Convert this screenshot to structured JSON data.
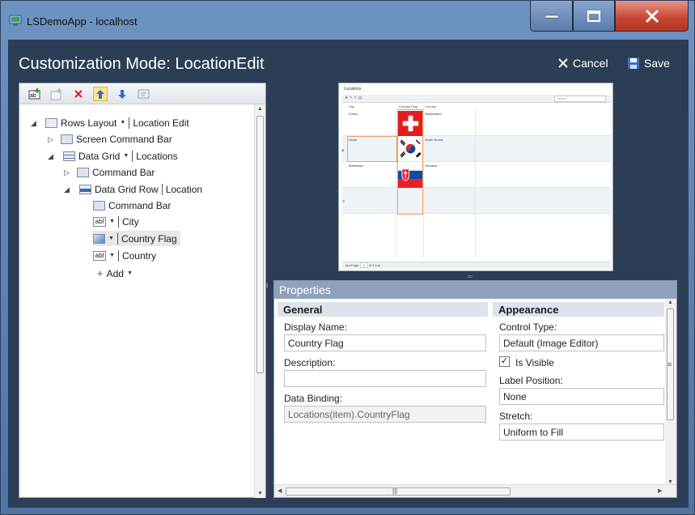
{
  "window": {
    "title": "LSDemoApp - localhost"
  },
  "header": {
    "title": "Customization Mode: LocationEdit",
    "cancel_label": "Cancel",
    "save_label": "Save"
  },
  "tree": {
    "rows_layout": "Rows Layout",
    "rows_layout_name": "Location Edit",
    "screen_command_bar": "Screen Command Bar",
    "data_grid": "Data Grid",
    "data_grid_name": "Locations",
    "command_bar": "Command Bar",
    "data_grid_row": "Data Grid Row",
    "data_grid_row_name": "Location",
    "row_command_bar": "Command Bar",
    "city": "City",
    "country_flag": "Country Flag",
    "country": "Country",
    "add": "Add",
    "textbox_icon_text": "abl"
  },
  "preview": {
    "title": "Locations",
    "search_placeholder": "Search",
    "columns": [
      "City",
      "Country Flag",
      "Country"
    ],
    "rows": [
      {
        "city": "Zurich",
        "country": "Switzerland",
        "flag": "switzerland"
      },
      {
        "city": "Seoul",
        "country": "South Korea",
        "flag": "south-korea"
      },
      {
        "city": "Bratislava",
        "country": "Slovakia",
        "flag": "slovakia"
      }
    ],
    "pager": {
      "page_label": "Page",
      "page": "1",
      "of": "of 1"
    }
  },
  "properties": {
    "title": "Properties",
    "general": {
      "heading": "General",
      "display_name_label": "Display Name:",
      "display_name": "Country Flag",
      "description_label": "Description:",
      "description": "",
      "data_binding_label": "Data Binding:",
      "data_binding": "Locations(item).CountryFlag"
    },
    "appearance": {
      "heading": "Appearance",
      "control_type_label": "Control Type:",
      "control_type": "Default (Image Editor)",
      "is_visible_label": "Is Visible",
      "is_visible": true,
      "label_position_label": "Label Position:",
      "label_position": "None",
      "stretch_label": "Stretch:",
      "stretch": "Uniform to Fill"
    }
  },
  "colors": {
    "client_bg": "#2c3d56",
    "close_red": "#c64431",
    "selection_orange": "#f0a060"
  }
}
